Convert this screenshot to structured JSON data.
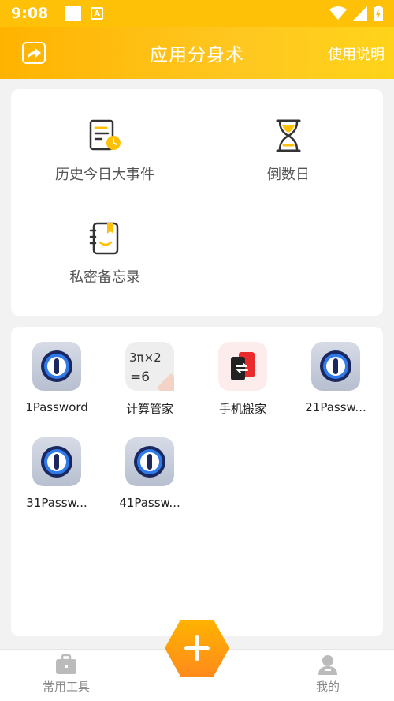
{
  "status_bar": {
    "time": "9:08"
  },
  "app_bar": {
    "title": "应用分身术",
    "help": "使用说明"
  },
  "tools": [
    {
      "label": "历史今日大事件",
      "icon": "history-document-icon"
    },
    {
      "label": "倒数日",
      "icon": "hourglass-icon"
    },
    {
      "label": "私密备忘录",
      "icon": "notebook-icon"
    }
  ],
  "apps": [
    {
      "name": "1Password",
      "icon": "1password-icon"
    },
    {
      "name": "计算管家",
      "icon": "calculator-app-icon"
    },
    {
      "name": "手机搬家",
      "icon": "phone-transfer-icon"
    },
    {
      "name": "21Passw...",
      "icon": "1password-icon"
    },
    {
      "name": "31Passw...",
      "icon": "1password-icon"
    },
    {
      "name": "41Passw...",
      "icon": "1password-icon"
    }
  ],
  "calc_icon_text": {
    "top": "3π×2",
    "bottom": "=6"
  },
  "tab_bar": {
    "left": "常用工具",
    "right": "我的"
  },
  "colors": {
    "accent": "#ffc107",
    "fab": "#ff9f1c",
    "icon_stroke": "#333333",
    "icon_yellow": "#ffc107"
  }
}
